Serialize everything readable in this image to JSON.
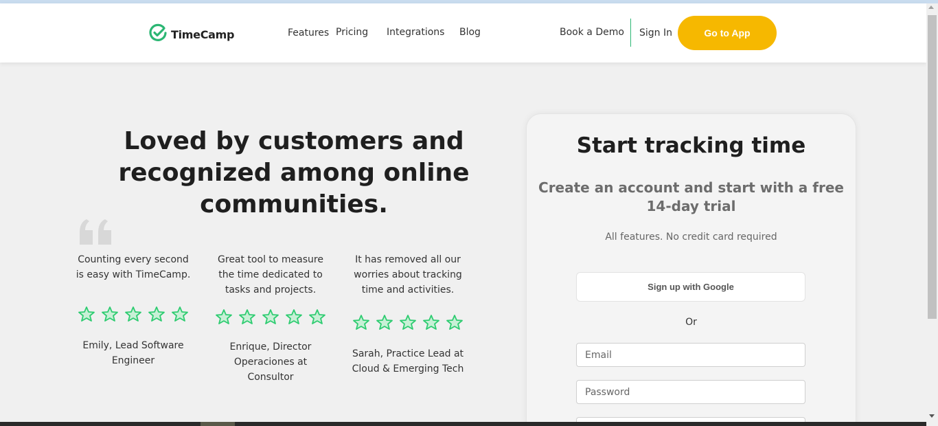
{
  "header": {
    "logo_text": "TimeCamp",
    "nav": [
      "Features",
      "Pricing",
      "Integrations",
      "Blog"
    ],
    "book_demo": "Book a Demo",
    "sign_in": "Sign In",
    "go_to_app": "Go to App"
  },
  "hero": {
    "title": "Loved by customers and recognized among online communities."
  },
  "testimonials": [
    {
      "quote": "Counting every second is easy with TimeCamp.",
      "author": "Emily, Lead Software Engineer",
      "rating": 5
    },
    {
      "quote": "Great tool to measure the time dedicated to tasks and projects.",
      "author": "Enrique, Director Operaciones at Consultor",
      "rating": 5
    },
    {
      "quote": "It has removed all our worries about tracking time and activities.",
      "author": "Sarah, Practice Lead at Cloud & Emerging Tech",
      "rating": 5
    }
  ],
  "signup": {
    "title": "Start tracking time",
    "subtitle": "Create an account and start with a free 14-day trial",
    "note": "All features. No credit card required",
    "google_button": "Sign up with Google",
    "or": "Or",
    "email_placeholder": "Email",
    "password_placeholder": "Password"
  },
  "colors": {
    "brand_green": "#2bb673",
    "cta_yellow": "#f6b800",
    "star_green": "#2ecc71"
  }
}
